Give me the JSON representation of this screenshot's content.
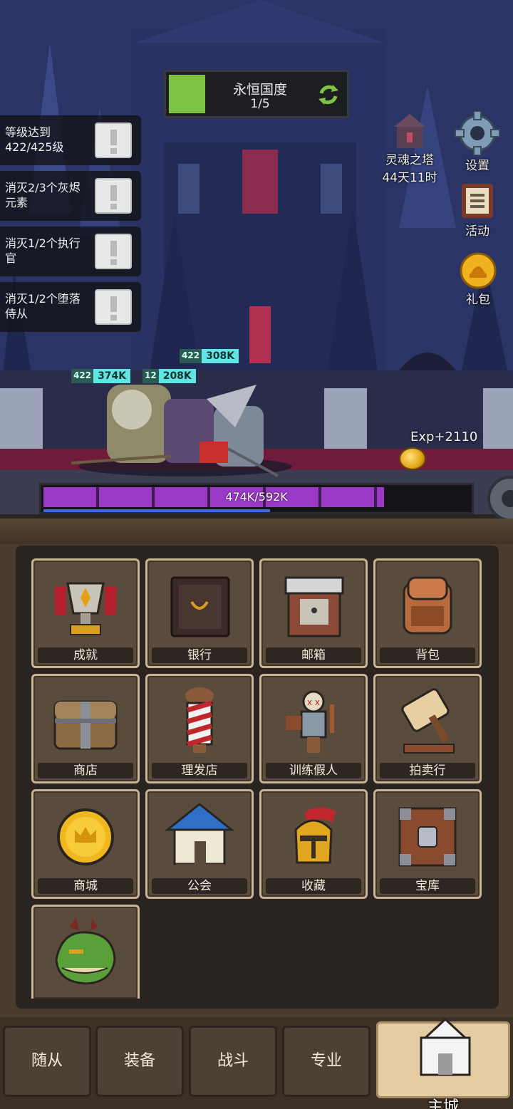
{
  "stage": {
    "name": "永恒国度",
    "progress": "1/5",
    "progress_fraction": 0.2
  },
  "quests": [
    {
      "text": "等级达到422/425级"
    },
    {
      "text": "消灭2/3个灰烬元素"
    },
    {
      "text": "消灭1/2个执行官"
    },
    {
      "text": "消灭1/2个堕落侍从"
    }
  ],
  "side_buttons": {
    "soul_tower": {
      "label": "灵魂之塔",
      "timer": "44天11时"
    },
    "settings": {
      "label": "设置"
    },
    "events": {
      "label": "活动"
    },
    "gift": {
      "label": "礼包"
    }
  },
  "heroes": [
    {
      "level": "422",
      "hp": "308K"
    },
    {
      "level": "422",
      "hp": "374K"
    },
    {
      "level": "12",
      "hp": "208K"
    }
  ],
  "exp_gain": "Exp+2110",
  "boss_hp": {
    "label": "474K/592K",
    "fraction": 0.8
  },
  "buildings": [
    {
      "label": "成就",
      "icon": "trophy-icon"
    },
    {
      "label": "银行",
      "icon": "safe-icon"
    },
    {
      "label": "邮箱",
      "icon": "mailbox-icon"
    },
    {
      "label": "背包",
      "icon": "backpack-icon"
    },
    {
      "label": "商店",
      "icon": "chest-icon"
    },
    {
      "label": "理发店",
      "icon": "barber-pole-icon"
    },
    {
      "label": "训练假人",
      "icon": "training-dummy-icon"
    },
    {
      "label": "拍卖行",
      "icon": "gavel-icon"
    },
    {
      "label": "商城",
      "icon": "gold-coin-icon"
    },
    {
      "label": "公会",
      "icon": "guild-house-icon"
    },
    {
      "label": "收藏",
      "icon": "helmet-icon"
    },
    {
      "label": "宝库",
      "icon": "vault-icon"
    },
    {
      "label": "",
      "icon": "dragon-icon"
    }
  ],
  "nav": [
    {
      "label": "随从"
    },
    {
      "label": "装备"
    },
    {
      "label": "战斗"
    },
    {
      "label": "专业"
    },
    {
      "label": "主城",
      "active": true
    }
  ],
  "colors": {
    "accent_green": "#7dc243",
    "hp_cyan": "#5fe6e3",
    "boss_purple": "#9a39c8",
    "frame_tan": "#c9b392"
  }
}
